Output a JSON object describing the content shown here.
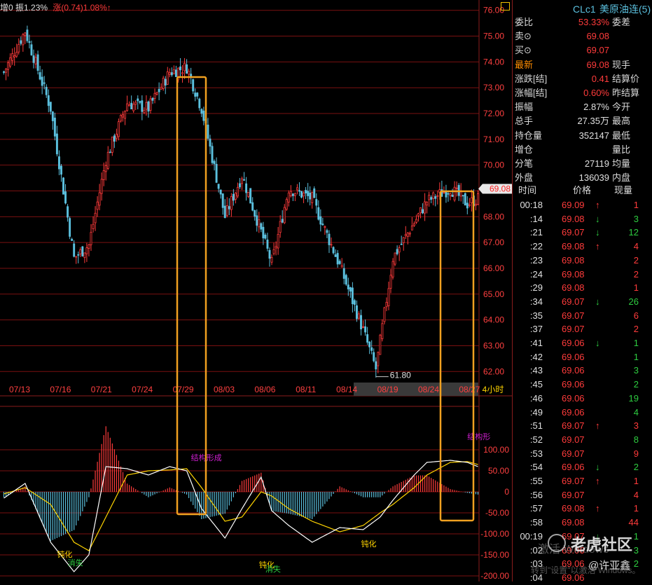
{
  "topbar": {
    "part1": "增0 振1.23%",
    "part2": "涨(0.74)1.08%↑"
  },
  "panel": {
    "symbol": "CLc1",
    "name": "美原油连(5)",
    "quote_rows": [
      {
        "k": "委比",
        "v": "53.33%",
        "k2": "委差",
        "vc": "#ff3b3b"
      },
      {
        "k": "卖⊙",
        "v": "69.08",
        "k2": "",
        "vc": "#ff3b3b"
      },
      {
        "k": "买⊙",
        "v": "69.07",
        "k2": "",
        "vc": "#ff3b3b"
      },
      {
        "k": "最新",
        "v": "69.08",
        "k2": "现手",
        "vc": "#ff3b3b",
        "kc": "#ff8c00"
      },
      {
        "k": "涨跌[结]",
        "v": "0.41",
        "k2": "结算价",
        "vc": "#ff3b3b"
      },
      {
        "k": "涨幅[结]",
        "v": "0.60%",
        "k2": "昨结算",
        "vc": "#ff3b3b"
      },
      {
        "k": "振幅",
        "v": "2.87%",
        "k2": "今开",
        "vc": "#e0e0e0"
      },
      {
        "k": "总手",
        "v": "27.35万",
        "k2": "最高",
        "vc": "#e0e0e0"
      },
      {
        "k": "持仓量",
        "v": "352147",
        "k2": "最低",
        "vc": "#e0e0e0"
      },
      {
        "k": "增仓",
        "v": "",
        "k2": "量比",
        "vc": "#e0e0e0"
      },
      {
        "k": "分笔",
        "v": "27119",
        "k2": "均量",
        "vc": "#e0e0e0"
      },
      {
        "k": "外盘",
        "v": "136039",
        "k2": "内盘",
        "vc": "#e0e0e0"
      }
    ],
    "tick_header": {
      "time": "时间",
      "price": "价格",
      "qty": "现量"
    },
    "ticks": [
      {
        "t": "00:18",
        "p": "69.09",
        "a": "↑",
        "q": "1",
        "qc": "#ff3b3b"
      },
      {
        "t": ":14",
        "p": "69.08",
        "a": "↓",
        "q": "3",
        "qc": "#2ecc40"
      },
      {
        "t": ":21",
        "p": "69.07",
        "a": "↓",
        "q": "12",
        "qc": "#2ecc40"
      },
      {
        "t": ":22",
        "p": "69.08",
        "a": "↑",
        "q": "4",
        "qc": "#ff3b3b"
      },
      {
        "t": ":23",
        "p": "69.08",
        "a": "",
        "q": "2",
        "qc": "#ff3b3b"
      },
      {
        "t": ":24",
        "p": "69.08",
        "a": "",
        "q": "2",
        "qc": "#ff3b3b"
      },
      {
        "t": ":29",
        "p": "69.08",
        "a": "",
        "q": "1",
        "qc": "#ff3b3b"
      },
      {
        "t": ":34",
        "p": "69.07",
        "a": "↓",
        "q": "26",
        "qc": "#2ecc40"
      },
      {
        "t": ":35",
        "p": "69.07",
        "a": "",
        "q": "6",
        "qc": "#ff3b3b"
      },
      {
        "t": ":37",
        "p": "69.07",
        "a": "",
        "q": "2",
        "qc": "#ff3b3b"
      },
      {
        "t": ":41",
        "p": "69.06",
        "a": "↓",
        "q": "1",
        "qc": "#2ecc40"
      },
      {
        "t": ":42",
        "p": "69.06",
        "a": "",
        "q": "1",
        "qc": "#2ecc40"
      },
      {
        "t": ":43",
        "p": "69.06",
        "a": "",
        "q": "3",
        "qc": "#2ecc40"
      },
      {
        "t": ":45",
        "p": "69.06",
        "a": "",
        "q": "2",
        "qc": "#2ecc40"
      },
      {
        "t": ":46",
        "p": "69.06",
        "a": "",
        "q": "19",
        "qc": "#2ecc40"
      },
      {
        "t": ":49",
        "p": "69.06",
        "a": "",
        "q": "4",
        "qc": "#2ecc40"
      },
      {
        "t": ":51",
        "p": "69.07",
        "a": "↑",
        "q": "3",
        "qc": "#ff3b3b"
      },
      {
        "t": ":52",
        "p": "69.07",
        "a": "",
        "q": "8",
        "qc": "#2ecc40"
      },
      {
        "t": ":53",
        "p": "69.07",
        "a": "",
        "q": "9",
        "qc": "#ff3b3b"
      },
      {
        "t": ":54",
        "p": "69.06",
        "a": "↓",
        "q": "2",
        "qc": "#2ecc40"
      },
      {
        "t": ":55",
        "p": "69.07",
        "a": "↑",
        "q": "1",
        "qc": "#ff3b3b"
      },
      {
        "t": ":56",
        "p": "69.07",
        "a": "",
        "q": "4",
        "qc": "#ff3b3b"
      },
      {
        "t": ":57",
        "p": "69.08",
        "a": "↑",
        "q": "1",
        "qc": "#ff3b3b"
      },
      {
        "t": ":58",
        "p": "69.08",
        "a": "",
        "q": "44",
        "qc": "#ff3b3b"
      },
      {
        "t": "00:19",
        "p": "69.07",
        "a": "↓",
        "q": "1",
        "qc": "#2ecc40"
      },
      {
        "t": ":02",
        "p": "69.06",
        "a": "",
        "q": "3",
        "qc": "#2ecc40"
      },
      {
        "t": ":03",
        "p": "69.06",
        "a": "",
        "q": "2",
        "qc": "#2ecc40"
      },
      {
        "t": ":04",
        "p": "69.06",
        "a": "",
        "q": "",
        "qc": "#2ecc40"
      }
    ]
  },
  "watermark": {
    "brand": "老虎社区",
    "user": "@许亚鑫",
    "activate1": "激活 Windows",
    "activate2": "转到\"设置\"以激活 Windows。"
  },
  "chart_data": [
    {
      "type": "candlestick",
      "ylim": [
        61.6,
        76.4
      ],
      "y_ticks": [
        "76.00",
        "75.00",
        "74.00",
        "73.00",
        "72.00",
        "71.00",
        "70.00",
        "69.00",
        "68.00",
        "67.00",
        "66.00",
        "65.00",
        "64.00",
        "63.00",
        "62.00"
      ],
      "y_tick_values": [
        76,
        75,
        74,
        73,
        72,
        71,
        70,
        69,
        68,
        67,
        66,
        65,
        64,
        63,
        62
      ],
      "x_labels": [
        "07/13",
        "07/16",
        "07/21",
        "07/24",
        "07/29",
        "08/03",
        "08/06",
        "08/11",
        "08/14",
        "08/19",
        "08/24",
        "08/27"
      ],
      "period_label": "4小时",
      "last_price": "69.08",
      "low_label": "61.80",
      "anchors": [
        [
          0,
          73.6
        ],
        [
          10,
          75.2
        ],
        [
          22,
          72.2
        ],
        [
          33,
          66.4
        ],
        [
          40,
          66.9
        ],
        [
          48,
          70.2
        ],
        [
          58,
          72.4
        ],
        [
          68,
          72.2
        ],
        [
          78,
          73.6
        ],
        [
          86,
          73.8
        ],
        [
          93,
          72.2
        ],
        [
          104,
          68.0
        ],
        [
          112,
          69.6
        ],
        [
          126,
          66.2
        ],
        [
          134,
          69.1
        ],
        [
          145,
          68.7
        ],
        [
          158,
          66.1
        ],
        [
          169,
          63.6
        ],
        [
          175,
          62.1
        ],
        [
          183,
          66.4
        ],
        [
          199,
          68.6
        ],
        [
          210,
          69.1
        ],
        [
          218,
          68.5
        ],
        [
          223,
          68.7
        ]
      ],
      "n_bars": 224,
      "highlight_boxes": [
        "07/29 peak",
        "08/27 recent"
      ]
    },
    {
      "type": "macd",
      "ylim": [
        -200,
        200
      ],
      "y_ticks": [
        "100.00",
        "50.00",
        "0",
        "-50.00",
        "-100.00",
        "-150.00",
        "-200.00"
      ],
      "y_tick_values": [
        100,
        50,
        0,
        -50,
        -100,
        -150,
        -200
      ],
      "dif_anchors": [
        [
          0,
          -15
        ],
        [
          10,
          20
        ],
        [
          22,
          -120
        ],
        [
          33,
          -190
        ],
        [
          40,
          -150
        ],
        [
          48,
          60
        ],
        [
          58,
          55
        ],
        [
          68,
          40
        ],
        [
          78,
          60
        ],
        [
          86,
          50
        ],
        [
          93,
          -40
        ],
        [
          104,
          -110
        ],
        [
          112,
          -40
        ],
        [
          121,
          35
        ],
        [
          126,
          -45
        ],
        [
          134,
          -80
        ],
        [
          145,
          -120
        ],
        [
          158,
          -85
        ],
        [
          169,
          -90
        ],
        [
          177,
          -60
        ],
        [
          183,
          -20
        ],
        [
          193,
          40
        ],
        [
          199,
          70
        ],
        [
          210,
          75
        ],
        [
          218,
          70
        ],
        [
          223,
          60
        ]
      ],
      "dea_anchors": [
        [
          0,
          -5
        ],
        [
          10,
          10
        ],
        [
          22,
          -30
        ],
        [
          33,
          -120
        ],
        [
          40,
          -140
        ],
        [
          48,
          -60
        ],
        [
          58,
          40
        ],
        [
          68,
          50
        ],
        [
          78,
          52
        ],
        [
          86,
          55
        ],
        [
          93,
          10
        ],
        [
          104,
          -70
        ],
        [
          112,
          -60
        ],
        [
          121,
          0
        ],
        [
          126,
          -10
        ],
        [
          134,
          -40
        ],
        [
          145,
          -70
        ],
        [
          158,
          -95
        ],
        [
          169,
          -80
        ],
        [
          177,
          -50
        ],
        [
          183,
          -30
        ],
        [
          193,
          10
        ],
        [
          199,
          40
        ],
        [
          210,
          70
        ],
        [
          218,
          72
        ],
        [
          223,
          65
        ]
      ],
      "annotations": [
        {
          "text": "结构形成",
          "color": "#d020d0",
          "at": [
            88,
            75
          ]
        },
        {
          "text": "结构形",
          "color": "#d020d0",
          "at": [
            218,
            125
          ]
        },
        {
          "text": "钝化",
          "color": "#ffd400",
          "at": [
            25,
            -155
          ]
        },
        {
          "text": "消失",
          "color": "#2ecc40",
          "at": [
            30,
            -175
          ]
        },
        {
          "text": "钝化",
          "color": "#ffd400",
          "at": [
            120,
            -180
          ]
        },
        {
          "text": "消失",
          "color": "#2ecc40",
          "at": [
            123,
            -190
          ]
        },
        {
          "text": "钝化",
          "color": "#ffd400",
          "at": [
            168,
            -130
          ]
        }
      ]
    }
  ],
  "colors": {
    "up": "#ff3b3b",
    "down": "#5bc0de",
    "grid": "#7a1010",
    "box": "#f0a020",
    "dif": "#ffffff",
    "dea": "#ffd400"
  }
}
